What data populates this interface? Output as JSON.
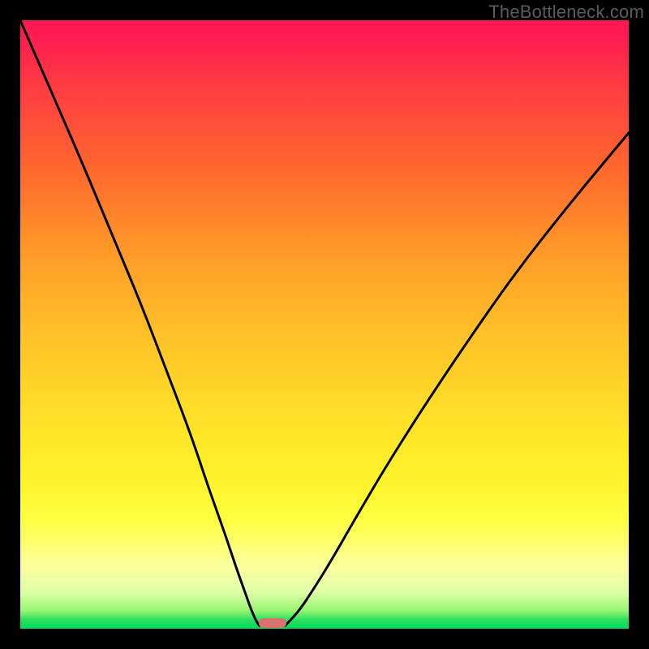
{
  "watermark": "TheBottleneck.com",
  "colors": {
    "page_bg": "#000000",
    "marker_fill": "#d9726e",
    "curve_stroke": "#000000"
  },
  "chart_data": {
    "type": "line",
    "title": "",
    "xlabel": "",
    "ylabel": "",
    "xlim": [
      0,
      100
    ],
    "ylim": [
      0,
      100
    ],
    "series": [
      {
        "name": "left-branch",
        "x": [
          0,
          5,
          10,
          15,
          20,
          24,
          28,
          31,
          33.5,
          35.5,
          37,
          38,
          38.8,
          39.3
        ],
        "y": [
          100,
          88.5,
          77,
          65,
          53,
          42.5,
          32,
          23,
          16,
          10,
          5.8,
          3.0,
          1.2,
          0.5
        ]
      },
      {
        "name": "right-branch",
        "x": [
          43.5,
          44.5,
          46,
          48,
          51,
          55,
          60,
          66,
          73,
          81,
          90,
          100
        ],
        "y": [
          0.5,
          1.5,
          3.2,
          6.2,
          11,
          18,
          26.5,
          36,
          46.5,
          58,
          69.5,
          81.5
        ]
      }
    ],
    "marker": {
      "x_center_pct": 41.5,
      "y_from_bottom_pct": 0.9
    },
    "annotations": []
  }
}
